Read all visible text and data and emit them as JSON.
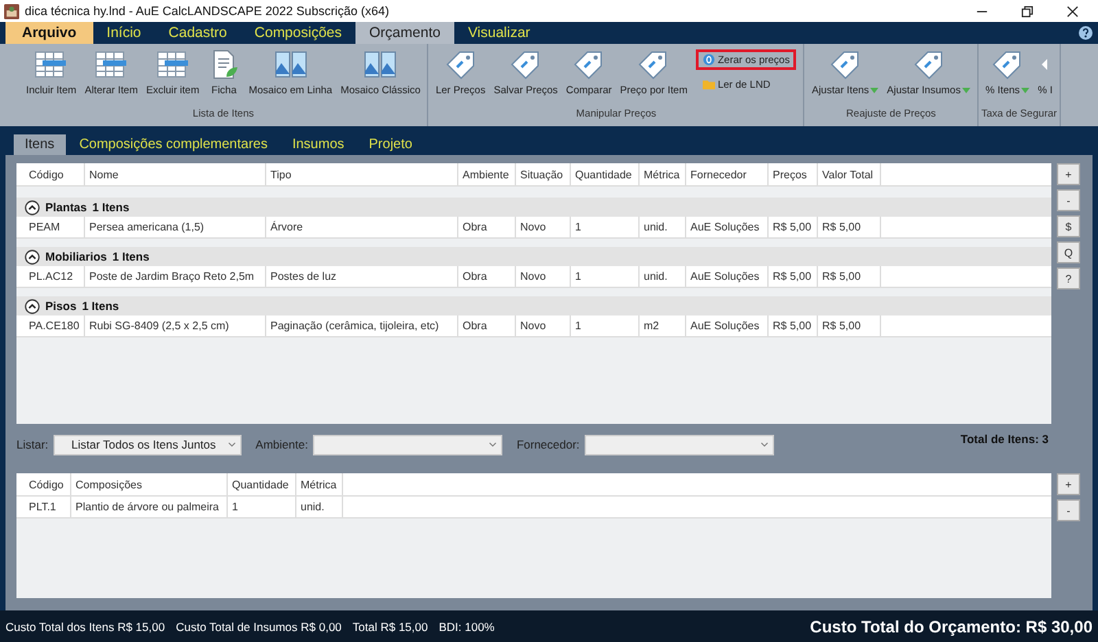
{
  "window": {
    "title": "dica técnica hy.lnd - AuE CalcLANDSCAPE 2022 Subscrição (x64)"
  },
  "menu_tabs": [
    {
      "label": "Arquivo",
      "kind": "file",
      "selected": false
    },
    {
      "label": "Início",
      "kind": "tab",
      "selected": false
    },
    {
      "label": "Cadastro",
      "kind": "tab",
      "selected": false
    },
    {
      "label": "Composições",
      "kind": "tab",
      "selected": false
    },
    {
      "label": "Orçamento",
      "kind": "tab",
      "selected": true
    },
    {
      "label": "Visualizar",
      "kind": "tab",
      "selected": false
    }
  ],
  "ribbon_groups": [
    {
      "label": "Lista de Itens",
      "buttons": [
        {
          "label": "Incluir Item",
          "kind": "table"
        },
        {
          "label": "Alterar Item",
          "kind": "table"
        },
        {
          "label": "Excluir item",
          "kind": "table"
        },
        {
          "label": "Ficha",
          "kind": "document"
        },
        {
          "label": "Mosaico em Linha",
          "kind": "mosaic"
        },
        {
          "label": "Mosaico Clássico",
          "kind": "mosaic"
        }
      ]
    },
    {
      "label": "Manipular Preços",
      "buttons": [
        {
          "label": "Ler Preços",
          "kind": "tag"
        },
        {
          "label": "Salvar Preços",
          "kind": "tag"
        },
        {
          "label": "Comparar",
          "kind": "tag"
        },
        {
          "label": "Preço por Item",
          "kind": "tag"
        }
      ],
      "small_buttons": [
        {
          "label": "Zerar os preços",
          "kind": "zero",
          "highlighted": true
        },
        {
          "label": "Ler de LND",
          "kind": "folder",
          "highlighted": false
        }
      ]
    },
    {
      "label": "Reajuste de Preços",
      "buttons": [
        {
          "label": "Ajustar Itens",
          "kind": "tag-dropdown"
        },
        {
          "label": "Ajustar Insumos",
          "kind": "tag-dropdown"
        }
      ]
    },
    {
      "label": "Taxa de Segurar",
      "buttons": [
        {
          "label": "% Itens",
          "kind": "tag-dropdown"
        },
        {
          "label": "% I",
          "kind": "arrow"
        }
      ]
    }
  ],
  "sub_tabs": [
    {
      "label": "Itens",
      "selected": true
    },
    {
      "label": "Composições complementares",
      "selected": false
    },
    {
      "label": "Insumos",
      "selected": false
    },
    {
      "label": "Projeto",
      "selected": false
    }
  ],
  "items_table": {
    "columns": [
      "Código",
      "Nome",
      "Tipo",
      "Ambiente",
      "Situação",
      "Quantidade",
      "Métrica",
      "Fornecedor",
      "Preços",
      "Valor Total"
    ],
    "groups": [
      {
        "name": "Plantas",
        "count": "1 Itens",
        "expanded": true,
        "rows": [
          [
            "PEAM",
            "Persea americana (1,5)",
            "Árvore",
            "Obra",
            "Novo",
            "1",
            "unid.",
            "AuE Soluções",
            "R$ 5,00",
            "R$ 5,00"
          ]
        ]
      },
      {
        "name": "Mobiliarios",
        "count": "1 Itens",
        "expanded": true,
        "rows": [
          [
            "PL.AC12",
            "Poste de Jardim Braço Reto 2,5m",
            "Postes de luz",
            "Obra",
            "Novo",
            "1",
            "unid.",
            "AuE Soluções",
            "R$ 5,00",
            "R$ 5,00"
          ]
        ]
      },
      {
        "name": "Pisos",
        "count": "1 Itens",
        "expanded": true,
        "rows": [
          [
            "PA.CE180",
            "Rubi SG-8409 (2,5 x 2,5 cm)",
            "Paginação (cerâmica, tijoleira, etc)",
            "Obra",
            "Novo",
            "1",
            "m2",
            "AuE Soluções",
            "R$ 5,00",
            "R$ 5,00"
          ]
        ]
      }
    ]
  },
  "side_buttons": [
    "+",
    "-",
    "$",
    "Q",
    "?"
  ],
  "filters": [
    {
      "label": "Listar:",
      "value": "Listar Todos os Itens Juntos"
    },
    {
      "label": "Ambiente:"
    },
    {
      "label": "Fornecedor:"
    }
  ],
  "total_items": "Total de Itens: 3",
  "compositions_table": {
    "columns": [
      "Código",
      "Composições",
      "Quantidade",
      "Métrica"
    ],
    "rows": [
      [
        "PLT.1",
        "Plantio de árvore ou palmeira",
        "1",
        "unid."
      ]
    ]
  },
  "bottom_side_buttons": [
    "+",
    "-"
  ],
  "status_bar": {
    "items": [
      "Custo Total dos Itens R$ 15,00",
      "Custo Total de Insumos R$ 0,00",
      "Total R$ 15,00",
      "BDI: 100%"
    ],
    "grand_total": "Custo Total do Orçamento: R$ 30,00"
  }
}
